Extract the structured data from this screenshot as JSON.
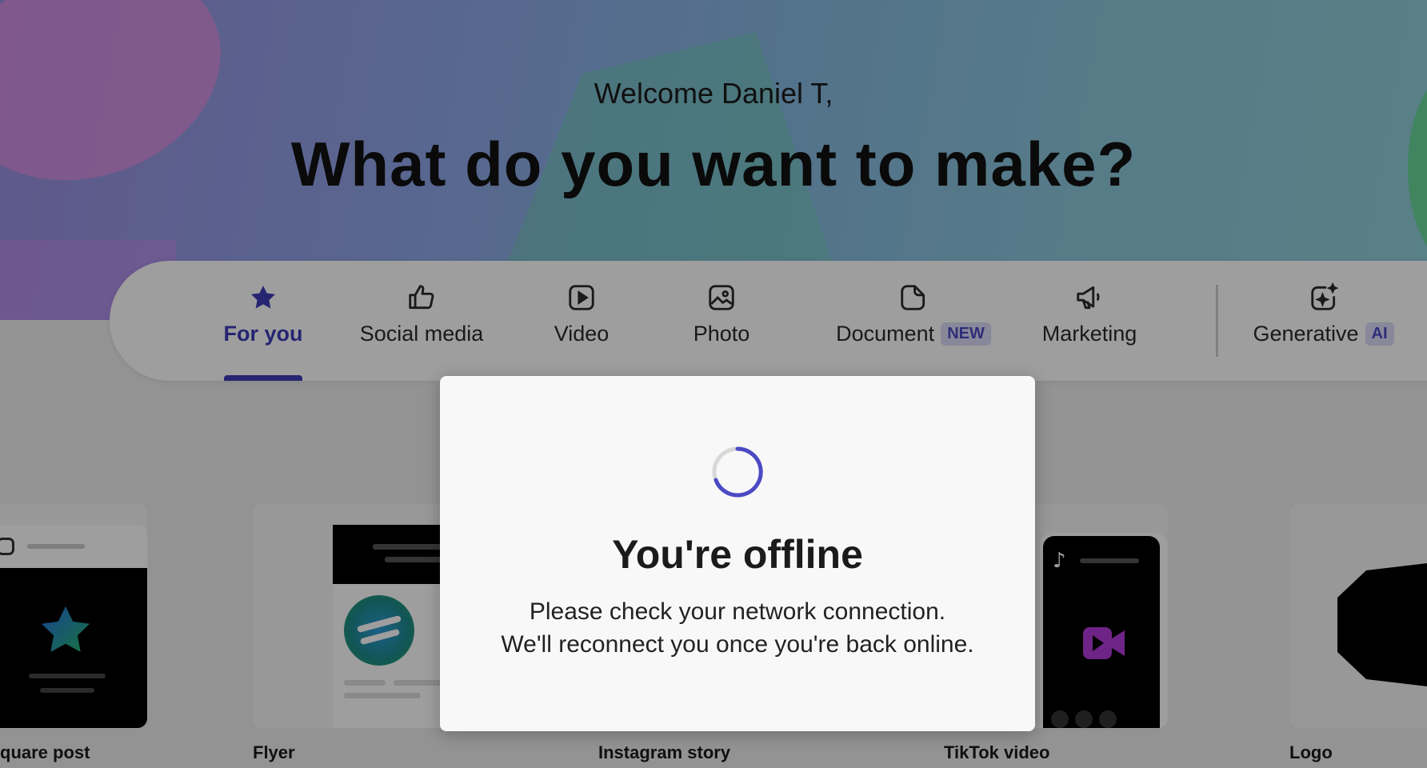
{
  "header": {
    "welcome": "Welcome Daniel T,",
    "headline": "What do you want to make?"
  },
  "categories": [
    {
      "label": "For you",
      "icon": "star-icon",
      "active": true
    },
    {
      "label": "Social media",
      "icon": "thumbs-up-icon"
    },
    {
      "label": "Video",
      "icon": "play-icon"
    },
    {
      "label": "Photo",
      "icon": "image-icon"
    },
    {
      "label": "Document",
      "icon": "document-icon",
      "badge": "NEW"
    },
    {
      "label": "Marketing",
      "icon": "megaphone-icon"
    },
    {
      "label": "Generative",
      "icon": "sparkle-image-icon",
      "badge": "AI"
    }
  ],
  "templates": [
    {
      "label": "quare post"
    },
    {
      "label": "Flyer"
    },
    {
      "label": "Instagram story"
    },
    {
      "label": "TikTok video"
    },
    {
      "label": "Logo"
    }
  ],
  "dialog": {
    "title": "You're offline",
    "line1": "Please check your network connection.",
    "line2": "We'll reconnect you once you're back online."
  },
  "colors": {
    "accent": "#3d3cb8",
    "badge_bg": "#dcdcf8"
  }
}
